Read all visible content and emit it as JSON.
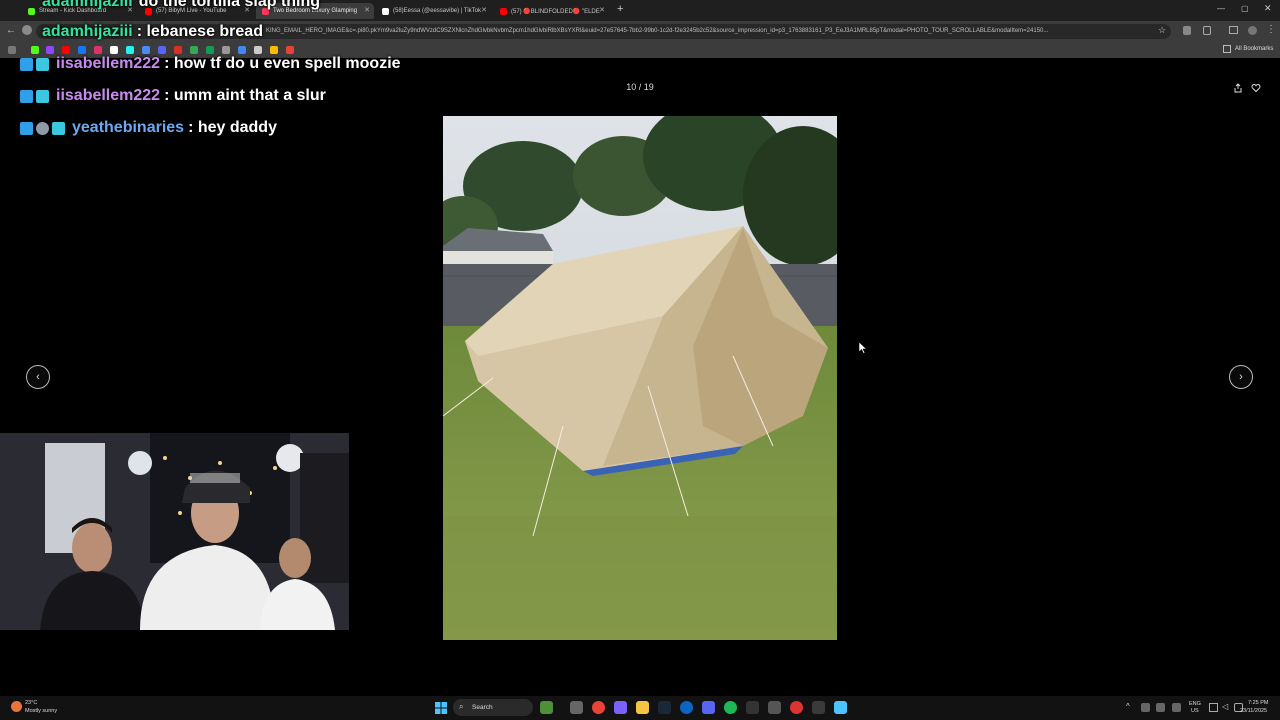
{
  "browser": {
    "tabs": [
      {
        "label": "Stream - Kick Dashboard",
        "color": "#53fc18"
      },
      {
        "label": "(57) BibyM Live - YouTube",
        "color": "#ff0000"
      },
      {
        "label": "Two Bedroom Luxury Glamping",
        "color": "#ff385c",
        "active": true
      },
      {
        "label": "(58)Eessa (@eessavibe) | TikTok",
        "color": "#ffffff"
      },
      {
        "label": "(57) 🔴BLINDFOLDED🔴 \"ELDE",
        "color": "#ff0000"
      }
    ],
    "url": "KING_EMAIL_HERO_IMAGE&c=.pi80.pkYm9va2luZy9ndWVzdC9SZXNlcnZhdGlvbkNvbmZpcm1hdGlvbiRlbXBsYXRl&euid=27e57645-7bb2-99b0-1c2d-f2e3245b2c52&source_impression_id=p3_1763883161_P3_EeJ3A1MRL85pT&modal=PHOTO_TOUR_SCROLLABLE&modalItem=24150...",
    "all_bookmarks": "All Bookmarks"
  },
  "chat": {
    "partial_top": {
      "user": "adamhijaziii",
      "message": "do the tortilla slap thing"
    },
    "lines": [
      {
        "user": "adamhijaziii",
        "message": ": lebanese bread",
        "user_color": "#33e3a0"
      },
      {
        "user": "iisabellem222",
        "message": ": how tf do u even spell moozie",
        "user_color": "#c88cf0"
      },
      {
        "user": "iisabellem222",
        "message": ": umm aint that a slur",
        "user_color": "#c88cf0"
      },
      {
        "user": "yeathebinaries",
        "message": ": hey daddy",
        "user_color": "#6ea8f0"
      }
    ]
  },
  "modal": {
    "counter": "10 / 19",
    "prev_icon": "‹",
    "next_icon": "›"
  },
  "taskbar": {
    "weather_temp": "23°C",
    "weather_desc": "Mostly sunny",
    "search_label": "Search",
    "lang_top": "ENG",
    "lang_bottom": "US",
    "time": "7:25 PM",
    "date": "23/11/2025"
  },
  "icons": {
    "share": "share-icon",
    "heart": "heart-icon",
    "windows": "windows-start-icon",
    "search": "search-icon"
  }
}
